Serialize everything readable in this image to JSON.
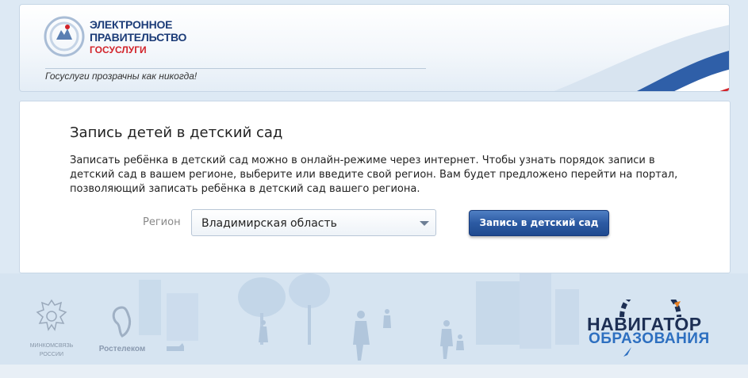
{
  "header": {
    "brand_line1": "ЭЛЕКТРОННОЕ",
    "brand_line2": "ПРАВИТЕЛЬСТВО",
    "brand_line3": "ГОСУСЛУГИ",
    "slogan": "Госуслуги прозрачны как никогда!",
    "logo_icon": "gosuslugi-logo-icon",
    "colors": {
      "blue": "#1c3c78",
      "red": "#d2232a"
    }
  },
  "main": {
    "title": "Запись детей в детский сад",
    "description": "Записать ребёнка в детский сад можно в онлайн-режиме через интернет. Чтобы узнать порядок записи в детский сад в вашем регионе, выберите или введите свой регион. Вам будет предложено перейти на портал, позволяющий записать ребёнка в детский сад вашего региона.",
    "region_label": "Регион",
    "region_value": "Владимирская область",
    "submit_label": "Запись в детский сад"
  },
  "footer": {
    "minkom_line1": "МИНКОМСВЯЗЬ",
    "minkom_line2": "РОССИИ",
    "rostelecom": "Ростелеком",
    "navigator_line1": "НАВИГАТОР",
    "navigator_line2": "ОБРАЗОВАНИЯ"
  }
}
